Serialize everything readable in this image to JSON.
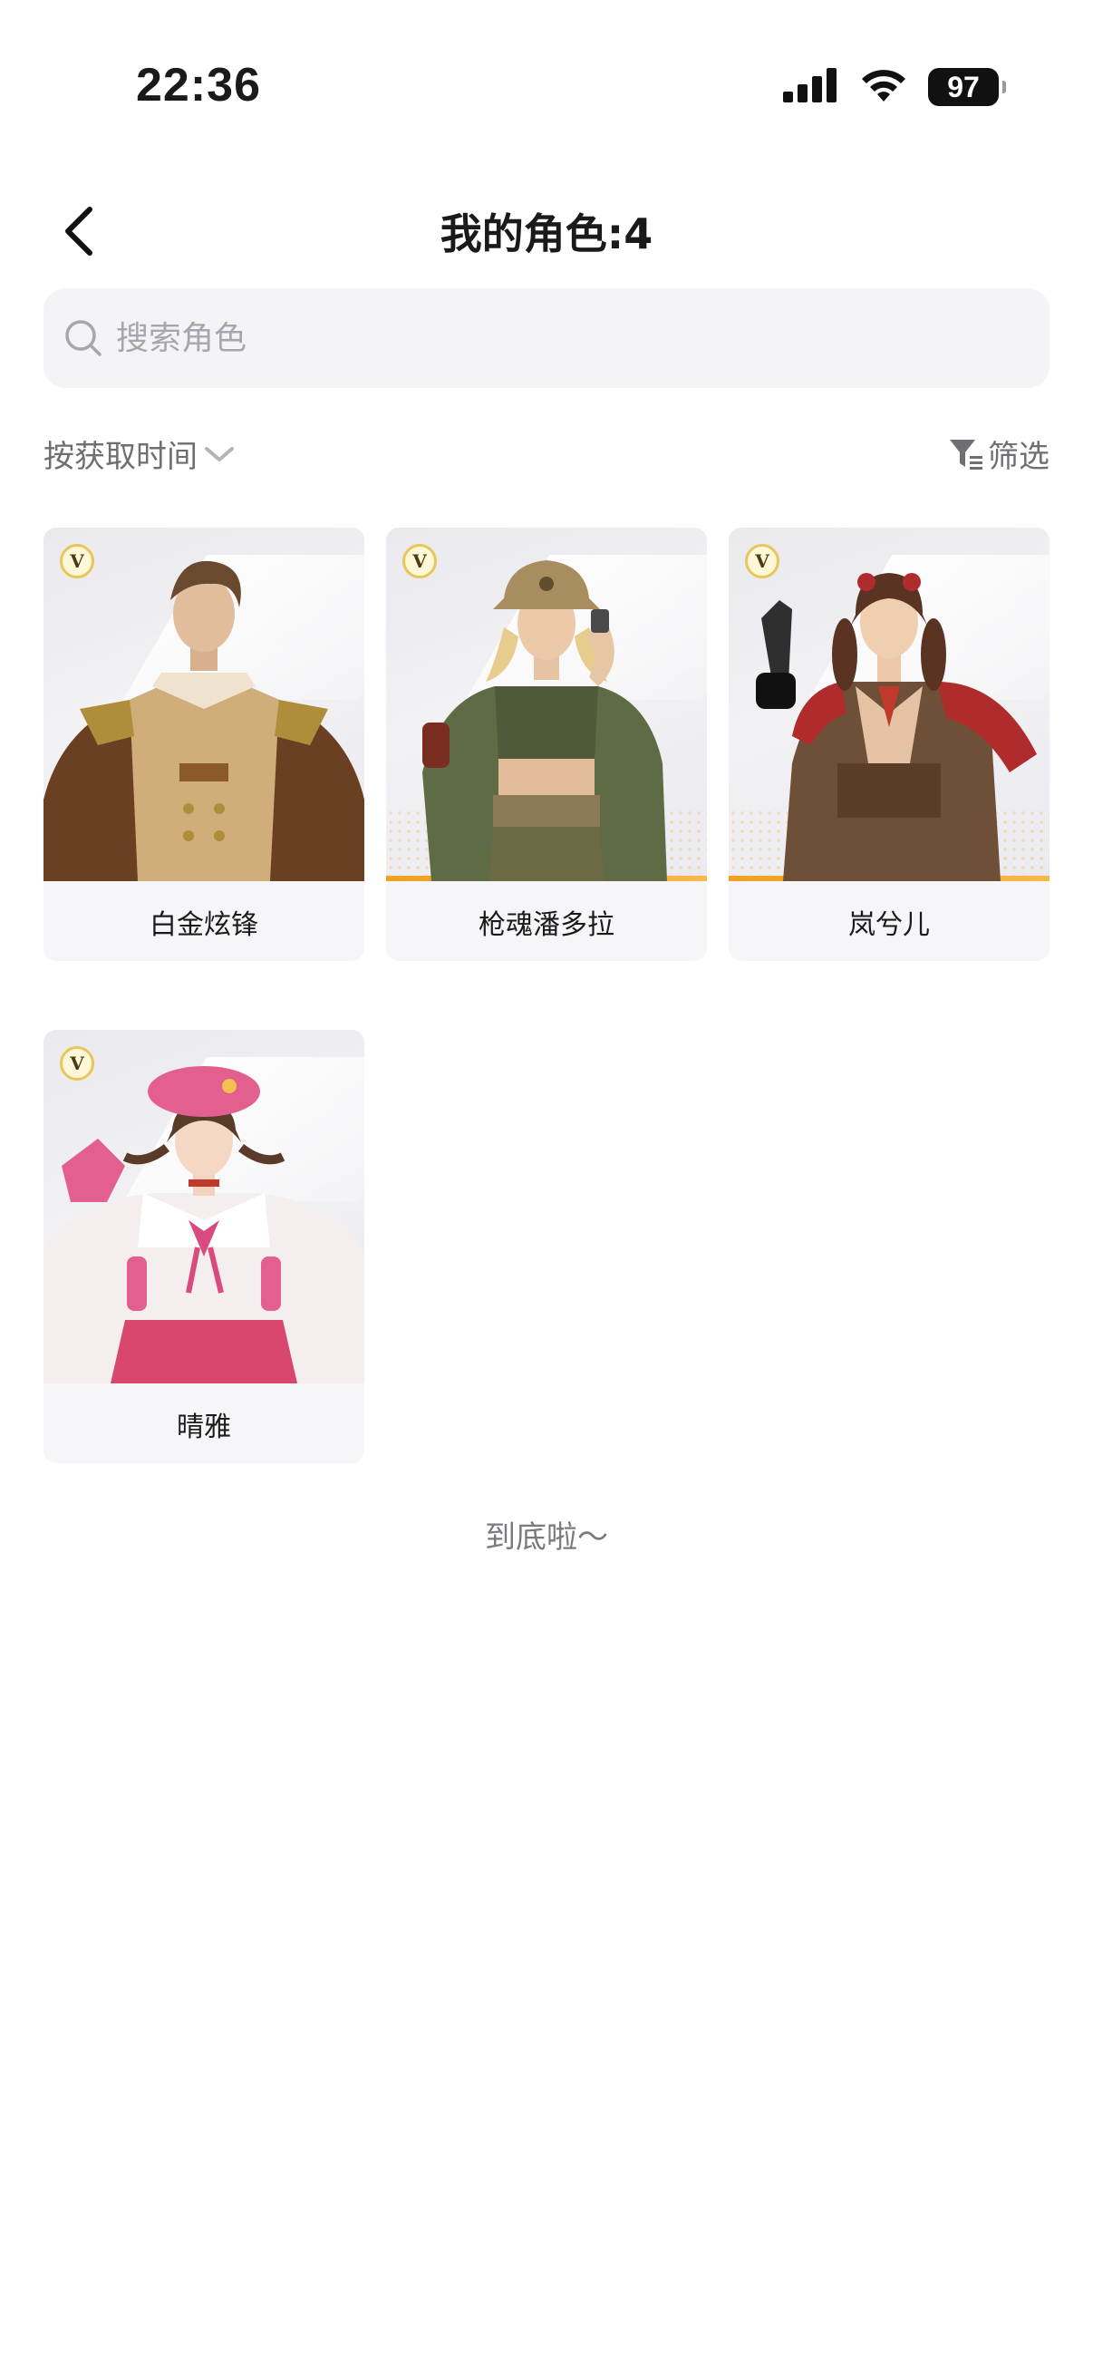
{
  "status_bar": {
    "time": "22:36",
    "battery": "97"
  },
  "header": {
    "title": "我的角色:4"
  },
  "search": {
    "placeholder": "搜索角色"
  },
  "toolbar": {
    "sort_label": "按获取时间",
    "filter_label": "筛选"
  },
  "characters": [
    {
      "name": "白金炫锋",
      "badge": "V"
    },
    {
      "name": "枪魂潘多拉",
      "badge": "V"
    },
    {
      "name": "岚兮儿",
      "badge": "V"
    },
    {
      "name": "晴雅",
      "badge": "V"
    }
  ],
  "footer": {
    "end_text": "到底啦～"
  },
  "colors": {
    "accent": "#f0a020",
    "background": "#ffffff",
    "card_background": "#f6f6f9",
    "muted_text": "#6e6e73"
  }
}
